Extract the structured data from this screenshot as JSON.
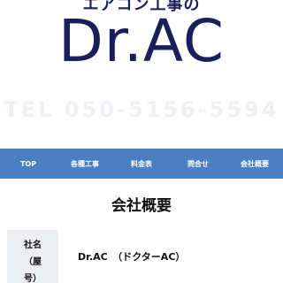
{
  "header": {
    "tagline": "エアコン工事の",
    "logo": "Dr.AC",
    "phone": "TEL 050-5156-5594"
  },
  "nav": {
    "items": [
      {
        "label": "TOP"
      },
      {
        "label": "各種工事"
      },
      {
        "label": "料金表"
      },
      {
        "label": "問合せ"
      },
      {
        "label": "会社概要"
      }
    ]
  },
  "section": {
    "title": "会社概要"
  },
  "company": {
    "label_lines": [
      "社名",
      "（屋",
      "号）"
    ],
    "value": "Dr.AC　（ドクターAC）"
  },
  "colors": {
    "brand_navy": "#1a1f5c",
    "nav_blue": "#4a80c2",
    "label_bg": "#eceef1"
  }
}
